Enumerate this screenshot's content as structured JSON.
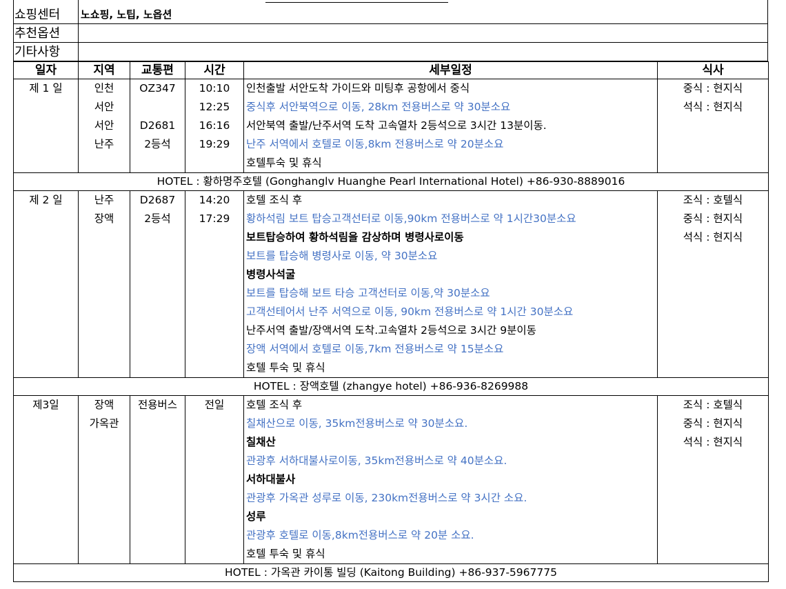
{
  "info": [
    {
      "label": "쇼핑센터",
      "value": "노쇼핑, 노팁, 노옵션"
    },
    {
      "label": "추천옵션",
      "value": ""
    },
    {
      "label": "기타사항",
      "value": ""
    }
  ],
  "headers": {
    "day": "일자",
    "region": "지역",
    "transport": "교통편",
    "time": "시간",
    "detail": "세부일정",
    "meal": "식사"
  },
  "days": [
    {
      "day": "제 1 일",
      "regions": [
        "인천",
        "서안",
        "서안",
        "난주",
        ""
      ],
      "transport": [
        "OZ347",
        "",
        "D2681",
        "2등석",
        ""
      ],
      "times": [
        "10:10",
        "12:25",
        "16:16",
        "19:29",
        ""
      ],
      "details": [
        {
          "text": "인천출발 서안도착 가이드와 미팅후 공항에서 중식",
          "style": "normal"
        },
        {
          "text": "중식후 서안북역으로 이동, 28km 전용버스로 약 30분소요",
          "style": "blue"
        },
        {
          "text": "서안북역 출발/난주서역 도착 고속열차 2등석으로 3시간 13분이동.",
          "style": "normal"
        },
        {
          "text": "난주 서역에서 호텔로 이동,8km 전용버스로 약 20분소요",
          "style": "blue"
        },
        {
          "text": "호텔투숙 및 휴식",
          "style": "normal"
        }
      ],
      "meals": [
        "중식 : 현지식",
        "석식 : 현지식",
        "",
        "",
        ""
      ],
      "hotel": "HOTEL : 황하명주호텔 (Gonghanglv Huanghe Pearl International Hotel) +86-930-8889016"
    },
    {
      "day": "제 2 일",
      "regions": [
        "난주",
        "장액",
        "",
        "",
        "",
        "",
        "",
        "",
        "",
        ""
      ],
      "transport": [
        "D2687",
        "2등석",
        "",
        "",
        "",
        "",
        "",
        "",
        "",
        ""
      ],
      "times": [
        "14:20",
        "17:29",
        "",
        "",
        "",
        "",
        "",
        "",
        "",
        ""
      ],
      "details": [
        {
          "text": "호텔 조식 후",
          "style": "normal"
        },
        {
          "text": "황하석림 보트 탑승고객선터로 이동,90km 전용버스로 약 1시간30분소요",
          "style": "blue"
        },
        {
          "text": "보트탑승하여 황하석림을 감상하며  병령사로이동",
          "style": "bold"
        },
        {
          "text": "보트를 탑승해 병령사로 이동, 약 30분소요",
          "style": "blue"
        },
        {
          "text": "병령사석굴",
          "style": "bold"
        },
        {
          "text": "보트를 탑승해 보트 타승 고객선터로 이동,약 30분소요",
          "style": "blue"
        },
        {
          "text": "고객선테어서 난주 서역으로 이동, 90km 전용버스로 약 1시간 30분소요",
          "style": "blue"
        },
        {
          "text": "난주서역 출발/장액서역 도착.고속열차 2등석으로 3시간 9분이동",
          "style": "normal"
        },
        {
          "text": "장액 서역에서 호텔로 이동,7km 전용버스로 약 15분소요",
          "style": "blue"
        },
        {
          "text": "호텔 투숙 및 휴식",
          "style": "normal"
        }
      ],
      "meals": [
        "조식 : 호텔식",
        "중식 : 현지식",
        "석식 : 현지식",
        "",
        "",
        "",
        "",
        "",
        "",
        ""
      ],
      "hotel": "HOTEL : 장액호텔 (zhangye hotel)  +86-936-8269988"
    },
    {
      "day": "제3일",
      "regions": [
        "장액",
        "가옥관",
        "",
        "",
        "",
        "",
        "",
        "",
        ""
      ],
      "transport": [
        "전용버스",
        "",
        "",
        "",
        "",
        "",
        "",
        "",
        ""
      ],
      "times": [
        "전일",
        "",
        "",
        "",
        "",
        "",
        "",
        "",
        ""
      ],
      "details": [
        {
          "text": "호텔 조식 후",
          "style": "normal"
        },
        {
          "text": "칠채산으로 이동, 35km전용버스로 약 30분소요.",
          "style": "blue"
        },
        {
          "text": "칠채산",
          "style": "bold"
        },
        {
          "text": "관광후 서하대불사로이동, 35km전용버스로 약 40분소요.",
          "style": "blue"
        },
        {
          "text": "서하대불사",
          "style": "bold"
        },
        {
          "text": "관광후 가옥관 성루로 이동, 230km전용버스로 약 3시간 소요.",
          "style": "blue"
        },
        {
          "text": "성루",
          "style": "bold"
        },
        {
          "text": "관광후 호텔로 이동,8km전용버스로 약 20분 소요.",
          "style": "blue"
        },
        {
          "text": "호텔 투숙 및 휴식",
          "style": "normal"
        }
      ],
      "meals": [
        "조식 : 호텔식",
        "중식 : 현지식",
        "석식 : 현지식",
        "",
        "",
        "",
        "",
        "",
        ""
      ],
      "hotel": "HOTEL :  가옥관 카이통 빌딩 (Kaitong Building) +86-937-5967775"
    }
  ],
  "colors": {
    "blue": "#4472c4"
  }
}
